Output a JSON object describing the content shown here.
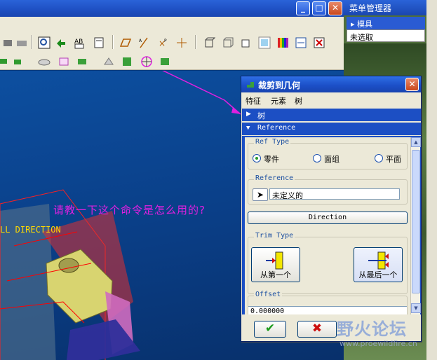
{
  "window": {
    "min_glyph": "_",
    "max_glyph": "□",
    "close_glyph": "✕"
  },
  "menu_manager": {
    "title": "菜单管理器",
    "items": [
      {
        "label": "模具"
      },
      {
        "label": "未选取"
      }
    ]
  },
  "viewport": {
    "annotation": "请教一下这个命令是怎么用的?",
    "direction_label": "LL DIRECTION"
  },
  "dialog": {
    "title": "裁剪到几何",
    "close_glyph": "✕",
    "menu": [
      "特征",
      "元素",
      "树"
    ],
    "sections": {
      "tree": "树",
      "reference": "Reference"
    },
    "ref_type": {
      "title": "Ref Type",
      "options": [
        {
          "label": "零件",
          "selected": true
        },
        {
          "label": "面组",
          "selected": false
        },
        {
          "label": "平面",
          "selected": false
        }
      ]
    },
    "reference": {
      "title": "Reference",
      "select_glyph": "➤",
      "value": "未定义的"
    },
    "direction_button": "Direction",
    "trim_type": {
      "title": "Trim Type",
      "from_first": "从第一个",
      "from_last": "从最后一个"
    },
    "offset": {
      "title": "Offset",
      "value": "0.000000"
    },
    "ok_glyph": "✔",
    "cancel_glyph": "✖"
  },
  "watermark": {
    "text": "野火论坛",
    "url": "www.proewildfire.cn"
  },
  "colors": {
    "annotation": "#e020e0",
    "direction_label": "#ffd900",
    "title_bar": "#1c50c8"
  }
}
